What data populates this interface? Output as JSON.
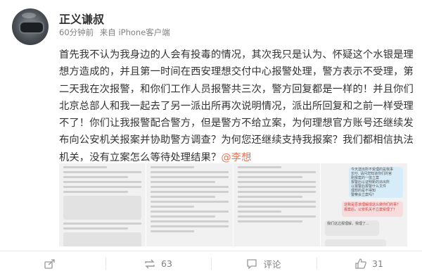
{
  "post": {
    "username": "正义谦叔",
    "time": "60分钟前",
    "source": "来自 iPhone客户端",
    "text": "首先我不认为我身边的人会有投毒的情况，其次我只是认为、怀疑这个水银是理想方造成的，并且第一时间在西安理想交付中心报警处理，警方表示不受理，第二天我在次报警，和你们工作人员报警共三次，警方回复都是一样的！并且你们北京总部人和我一起去了另一派出所再次说明情况，派出所回复和之前一样受理不了！你们让我报警配合警方，但是警方不给立案，为何理想官方账号还继续发布向公安机关报案并协助警方调查？为何您还继续支持我报案？我们都相信执法机关，没有立案怎么等待处理结果？",
    "mention": "@李想"
  },
  "images": {
    "img4_lines": [
      "今天送出所不受理的是我事",
      "长吵, 请问您知道你们的官",
      "刚报案的一体立案",
      "报警后以证明新的派出所",
      "以报警后报警什么文件",
      "理想的是不得知",
      "警察会立案吗？"
    ],
    "img4_question": "这我是否该理解成这么做你们的事？",
    "img4_question2": "报案后，公安机关不立案受理了？",
    "img4_reply": "我们这边报理解，我理了..."
  },
  "actions": {
    "share_count": "",
    "repost_count": "63",
    "comment_label": "评论",
    "like_count": "31"
  },
  "colors": {
    "mention": "#eb7350",
    "meta": "#808080"
  }
}
